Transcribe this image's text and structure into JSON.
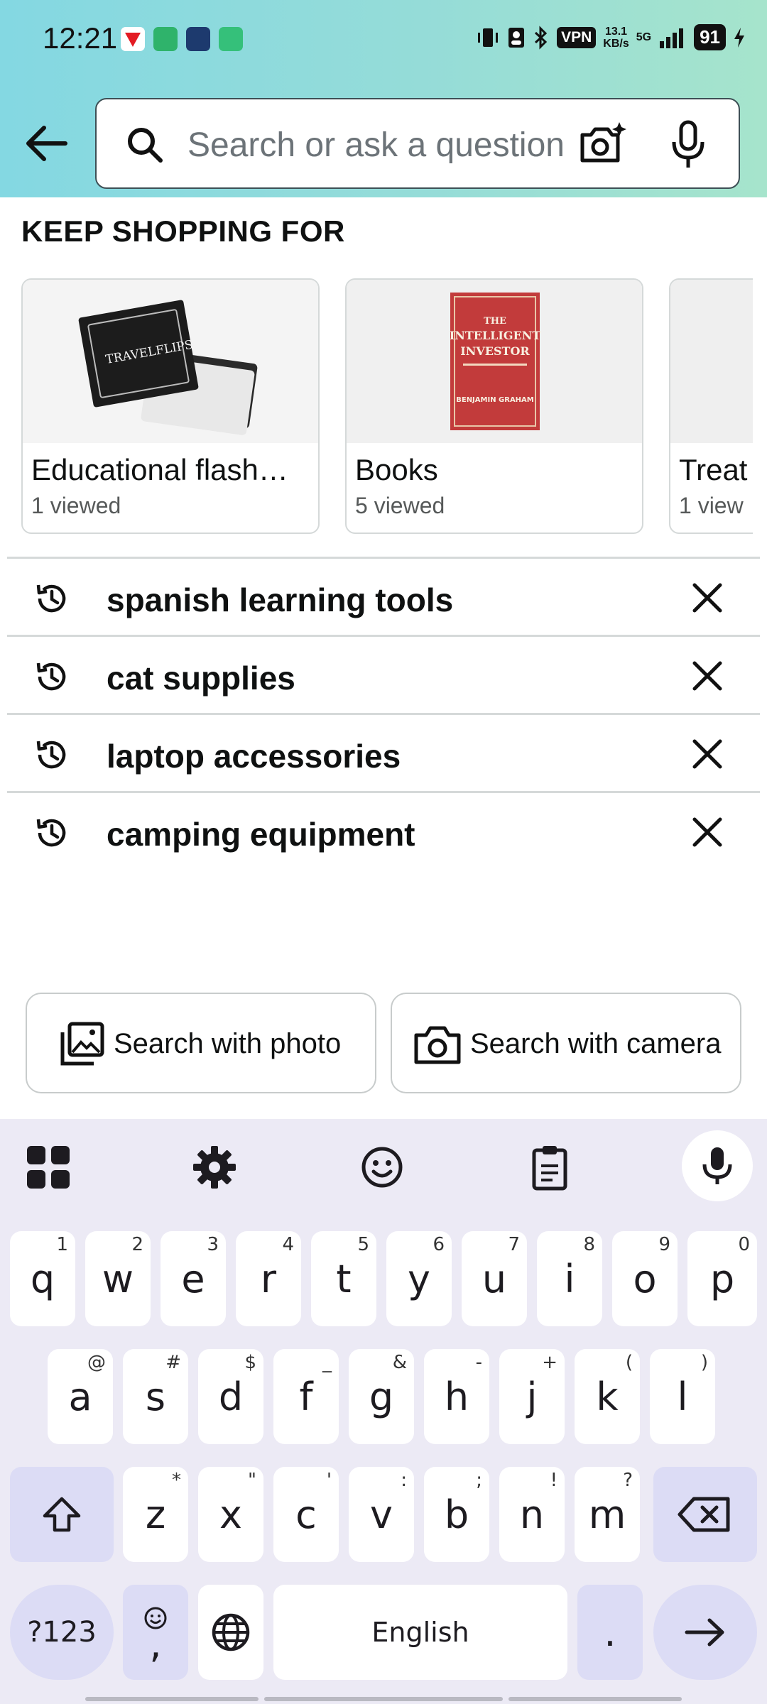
{
  "status_bar": {
    "time": "12:21",
    "vpn": "VPN",
    "speed_value": "13.1",
    "speed_unit": "KB/s",
    "network": "5G",
    "battery": "91"
  },
  "search": {
    "placeholder": "Search or ask a question",
    "value": ""
  },
  "keep_shopping": {
    "title": "KEEP SHOPPING FOR",
    "cards": [
      {
        "title": "Educational flash…",
        "subtitle": "1 viewed",
        "image": "flashcards-box"
      },
      {
        "title": "Books",
        "subtitle": "5 viewed",
        "image": "intelligent-investor-book"
      },
      {
        "title": "Treat",
        "subtitle": "1 view",
        "image": "product"
      }
    ],
    "book_cover": {
      "line1": "THE",
      "line2": "INTELLIGENT",
      "line3": "INVESTOR",
      "author": "BENJAMIN GRAHAM"
    },
    "flashcard_brand": "TRAVELFLIPS"
  },
  "history": [
    {
      "label": "spanish learning tools"
    },
    {
      "label": "cat supplies"
    },
    {
      "label": "laptop accessories"
    },
    {
      "label": "camping equipment"
    }
  ],
  "buttons": {
    "search_photo": "Search with photo",
    "search_camera": "Search with camera"
  },
  "keyboard": {
    "row1": [
      {
        "k": "q",
        "h": "1"
      },
      {
        "k": "w",
        "h": "2"
      },
      {
        "k": "e",
        "h": "3"
      },
      {
        "k": "r",
        "h": "4"
      },
      {
        "k": "t",
        "h": "5"
      },
      {
        "k": "y",
        "h": "6"
      },
      {
        "k": "u",
        "h": "7"
      },
      {
        "k": "i",
        "h": "8"
      },
      {
        "k": "o",
        "h": "9"
      },
      {
        "k": "p",
        "h": "0"
      }
    ],
    "row2": [
      {
        "k": "a",
        "h": "@"
      },
      {
        "k": "s",
        "h": "#"
      },
      {
        "k": "d",
        "h": "$"
      },
      {
        "k": "f",
        "h": "_"
      },
      {
        "k": "g",
        "h": "&"
      },
      {
        "k": "h",
        "h": "-"
      },
      {
        "k": "j",
        "h": "+"
      },
      {
        "k": "k",
        "h": "("
      },
      {
        "k": "l",
        "h": ")"
      }
    ],
    "row3": [
      {
        "k": "z",
        "h": "*"
      },
      {
        "k": "x",
        "h": "\""
      },
      {
        "k": "c",
        "h": "'"
      },
      {
        "k": "v",
        "h": ":"
      },
      {
        "k": "b",
        "h": ";"
      },
      {
        "k": "n",
        "h": "!"
      },
      {
        "k": "m",
        "h": "?"
      }
    ],
    "symbols_key": "?123",
    "comma_key": ",",
    "space_key": "English",
    "period_key": "."
  },
  "colors": {
    "header_start": "#84d8e2",
    "header_end": "#a6e4cc",
    "keyboard_bg": "#eceaf5",
    "special_key": "#dcdcf5"
  }
}
